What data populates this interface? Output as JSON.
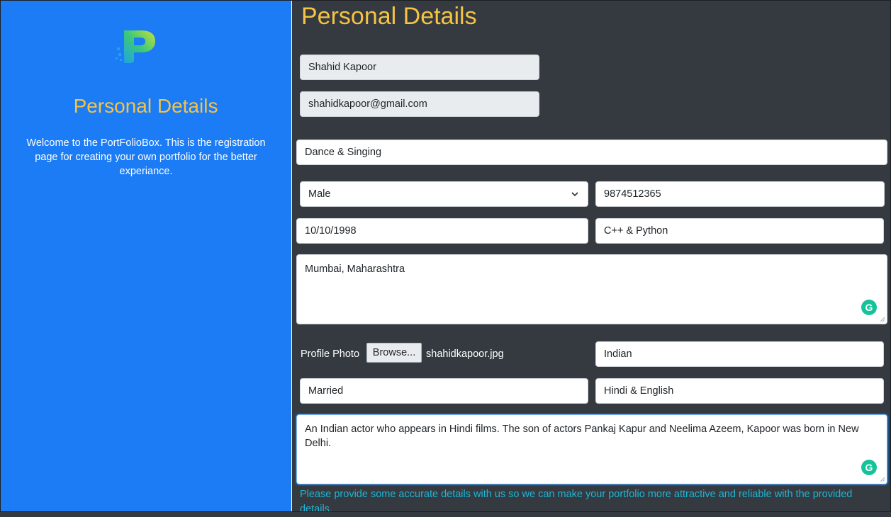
{
  "sidebar": {
    "title": "Personal Details",
    "description": "Welcome to the PortFolioBox. This is the registration page for creating your own portfolio for the better experiance."
  },
  "main": {
    "title": "Personal Details"
  },
  "form": {
    "name": "Shahid Kapoor",
    "email": "shahidkapoor@gmail.com",
    "hobbies": "Dance & Singing",
    "gender": "Male",
    "phone": "9874512365",
    "dob": "10/10/1998",
    "skills": "C++ & Python",
    "address": "Mumbai, Maharashtra",
    "photo_label": "Profile Photo",
    "browse_label": "Browse...",
    "photo_file": "shahidkapoor.jpg",
    "nationality": "Indian",
    "marital_status": "Married",
    "languages": "Hindi & English",
    "bio": "An Indian actor who appears in Hindi films. The son of actors Pankaj Kapur and Neelima Azeem, Kapoor was born in New Delhi."
  },
  "help_text": "Please provide some accurate details with us so we can make your portfolio more attractive and reliable with the provided details.",
  "colors": {
    "sidebar_bg": "#1b7cf5",
    "main_bg": "#343a40",
    "heading": "#f6c343",
    "help": "#1fb5d6",
    "grammarly": "#15c39a"
  },
  "icons": {
    "logo": "portfoliobox-logo",
    "select": "chevron-down-icon",
    "assistant": "grammarly-icon"
  }
}
